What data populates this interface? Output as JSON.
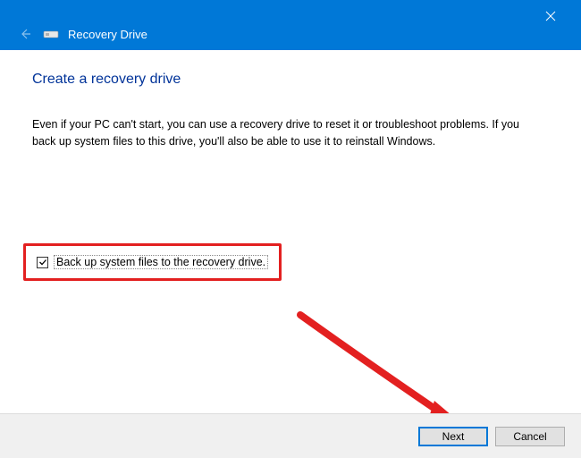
{
  "titlebar": {
    "title": "Recovery Drive"
  },
  "content": {
    "heading": "Create a recovery drive",
    "description": "Even if your PC can't start, you can use a recovery drive to reset it or troubleshoot problems. If you back up system files to this drive, you'll also be able to use it to reinstall Windows."
  },
  "checkbox": {
    "label": "Back up system files to the recovery drive.",
    "checked": true
  },
  "footer": {
    "next_label": "Next",
    "cancel_label": "Cancel"
  }
}
